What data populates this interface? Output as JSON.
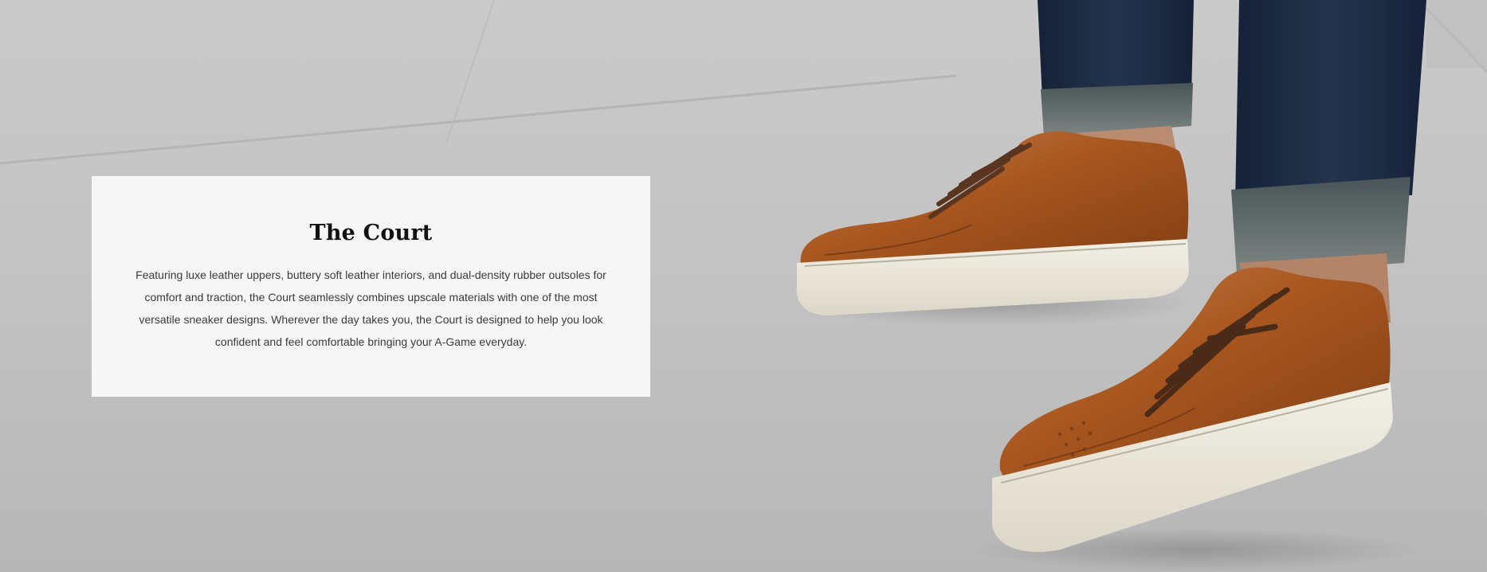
{
  "hero": {
    "image_alt": "Brown leather Court sneakers with white soles worn with cuffed denim jeans on a concrete sidewalk",
    "colors": {
      "background": "#c4c3c3",
      "card": "#f6f6f6",
      "leather": "#a4521f",
      "denim": "#1f2e44",
      "sole": "#ece8dc"
    }
  },
  "card": {
    "title": "The Court",
    "body": "Featuring luxe leather uppers, buttery soft leather interiors, and dual-density rubber outsoles for comfort and traction, the Court seamlessly combines upscale materials with one of the most versatile sneaker designs. Wherever the day takes you, the Court is designed to help you look confident and feel comfortable bringing your A-Game everyday."
  }
}
